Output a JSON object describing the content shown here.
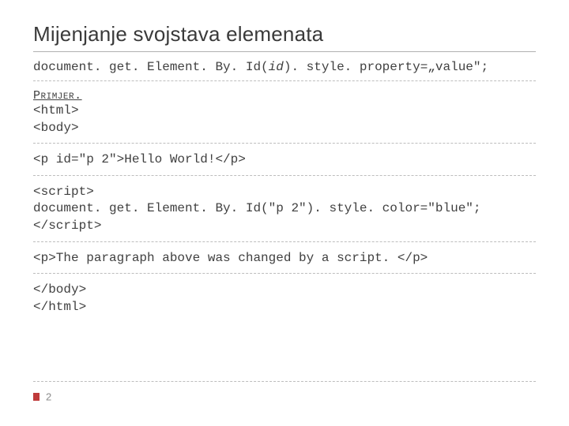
{
  "title": "Mijenjanje svojstava elemenata",
  "syntax": {
    "prefix": "document. get. Element. By. Id(",
    "arg": "id",
    "suffix": "). style. property=„value\";"
  },
  "example_label": "Primjer.",
  "code": {
    "l1": "<html>",
    "l2": "<body>",
    "l3": "<p id=\"p 2\">Hello World!</p>",
    "l4": "<script>",
    "l5": "document. get. Element. By. Id(\"p 2\"). style. color=\"blue\";",
    "l6": "</script>",
    "l7": "<p>The paragraph above was changed by a script. </p>",
    "l8": "</body>",
    "l9": "</html>"
  },
  "page_number": "2"
}
